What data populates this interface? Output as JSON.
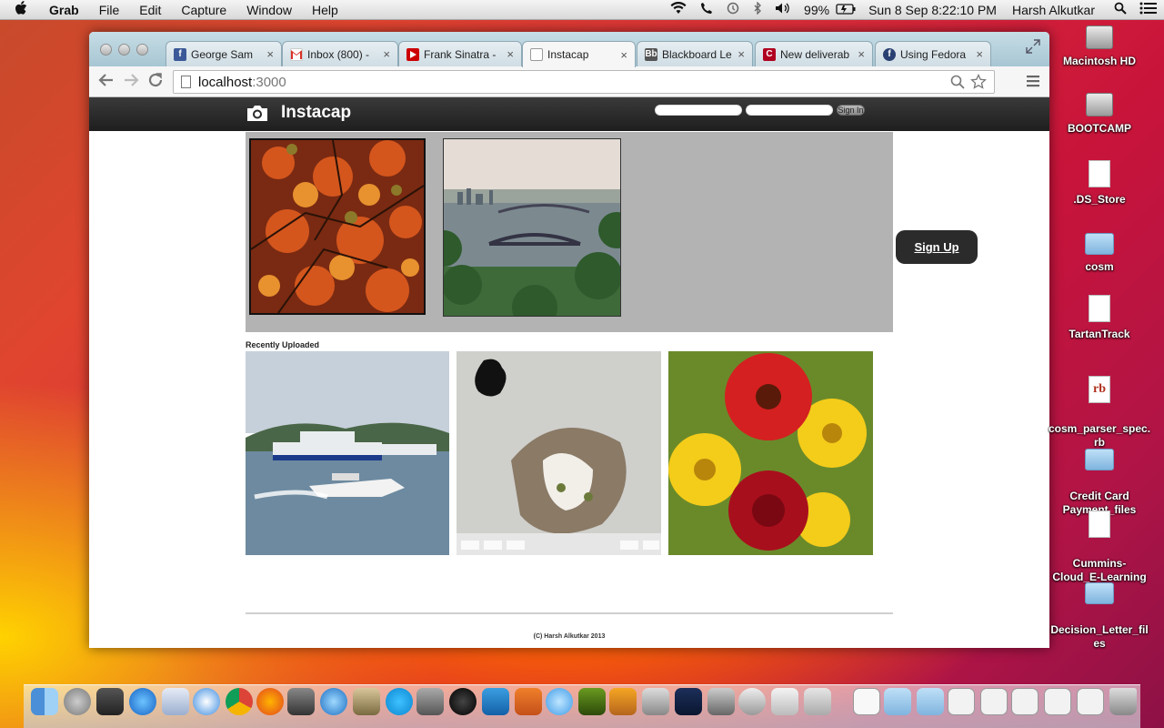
{
  "menubar": {
    "app_name": "Grab",
    "menus": [
      "File",
      "Edit",
      "Capture",
      "Window",
      "Help"
    ],
    "battery": "99%",
    "datetime": "Sun 8 Sep  8:22:10 PM",
    "user": "Harsh Alkutkar"
  },
  "browser": {
    "tabs": [
      {
        "title": "George Sam",
        "favicon": "facebook-icon",
        "color": "#3b5998"
      },
      {
        "title": "Inbox (800) -",
        "favicon": "gmail-icon",
        "color": "#d93025"
      },
      {
        "title": "Frank Sinatra -",
        "favicon": "youtube-icon",
        "color": "#cc0000"
      },
      {
        "title": "Instacap",
        "favicon": "page-icon",
        "color": "#ffffff",
        "active": true
      },
      {
        "title": "Blackboard Le",
        "favicon": "blackboard-icon",
        "color": "#555555"
      },
      {
        "title": "New deliverab",
        "favicon": "c-icon",
        "color": "#b00020"
      },
      {
        "title": "Using Fedora",
        "favicon": "fedora-icon",
        "color": "#294172"
      }
    ],
    "url_host": "localhost",
    "url_port": ":3000"
  },
  "site": {
    "brand": "Instacap",
    "signin_label": "Sign In",
    "signup_label": "Sign Up",
    "recent_title": "Recently Uploaded",
    "footer": "(C) Harsh Alkutkar 2013",
    "hero_photos": [
      "autumn-leaves-photo",
      "city-bridges-photo"
    ],
    "recent_photos": [
      "speedboat-photo",
      "cat-photo",
      "flowers-photo"
    ]
  },
  "desktop": {
    "icons": [
      {
        "label": "Macintosh HD",
        "kind": "hd"
      },
      {
        "label": "BOOTCAMP",
        "kind": "hd"
      },
      {
        "label": ".DS_Store",
        "kind": "file"
      },
      {
        "label": "cosm",
        "kind": "folder"
      },
      {
        "label": "TartanTrack",
        "kind": "file"
      },
      {
        "label": "cosm_parser_spec.\nrb",
        "kind": "file"
      },
      {
        "label": "Credit Card\nPayment_files",
        "kind": "folder"
      },
      {
        "label": "Cummins-\nCloud_E-Learning",
        "kind": "file"
      },
      {
        "label": "Decision_Letter_fil\nes",
        "kind": "folder"
      }
    ]
  },
  "colors": {
    "navbar": "#2a2a2a",
    "hero_bg": "#b3b3b3",
    "signup_bg": "#2b2b2b"
  }
}
